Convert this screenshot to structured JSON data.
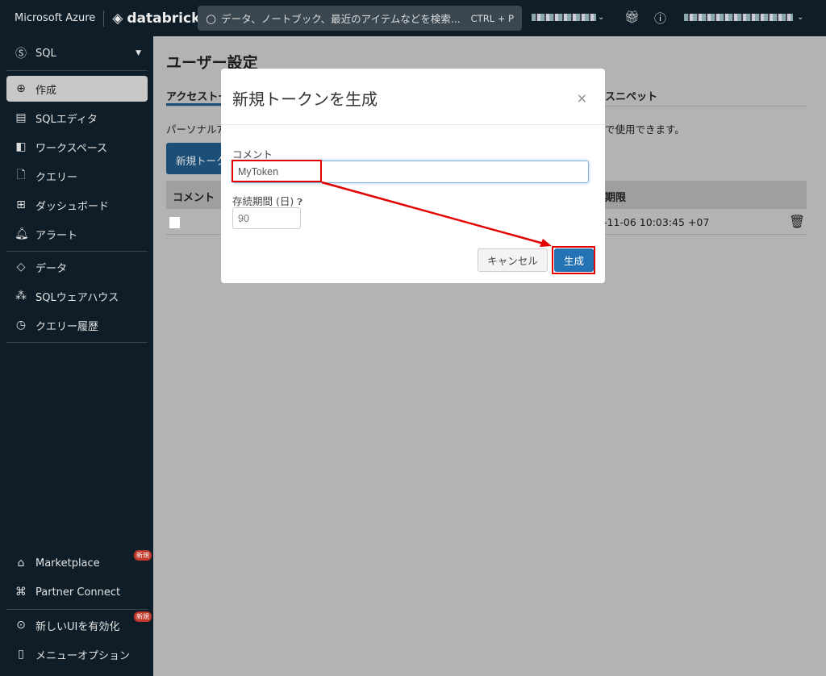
{
  "topbar": {
    "azure": "Microsoft Azure",
    "brand": "databricks",
    "search_placeholder": "データ、ノートブック、最近のアイテムなどを検索...",
    "search_shortcut": "CTRL + P"
  },
  "sidebar": {
    "persona": "SQL",
    "items": [
      {
        "label": "作成",
        "icon": "plus-circle-icon"
      },
      {
        "label": "SQLエディタ",
        "icon": "editor-icon"
      },
      {
        "label": "ワークスペース",
        "icon": "workspace-icon"
      },
      {
        "label": "クエリー",
        "icon": "query-icon"
      },
      {
        "label": "ダッシュボード",
        "icon": "dashboard-icon"
      },
      {
        "label": "アラート",
        "icon": "bell-icon"
      },
      {
        "label": "データ",
        "icon": "data-icon"
      },
      {
        "label": "SQLウェアハウス",
        "icon": "warehouse-icon"
      },
      {
        "label": "クエリー履歴",
        "icon": "history-icon"
      }
    ],
    "bottom": [
      {
        "label": "Marketplace",
        "badge": "新規"
      },
      {
        "label": "Partner Connect"
      },
      {
        "label": "新しいUIを有効化",
        "badge": "新規"
      },
      {
        "label": "メニューオプション"
      }
    ]
  },
  "page": {
    "title": "ユーザー設定",
    "tab_access": "アクセストー",
    "tab_snippet": "スニペット",
    "desc_left": "パーソナル7",
    "desc_right": "で使用できます。",
    "new_token_btn": "新規トーク",
    "col_comment": "コメント",
    "col_expiry": "期限",
    "row_expiry": "-11-06 10:03:45 +07"
  },
  "modal": {
    "title": "新規トークンを生成",
    "close": "×",
    "comment_label": "コメント",
    "comment_value": "MyToken",
    "lifetime_label": "存続期間 (日)",
    "lifetime_value": "90",
    "cancel": "キャンセル",
    "generate": "生成"
  },
  "colors": {
    "primary": "#2272b4",
    "annotation": "#e30000"
  }
}
